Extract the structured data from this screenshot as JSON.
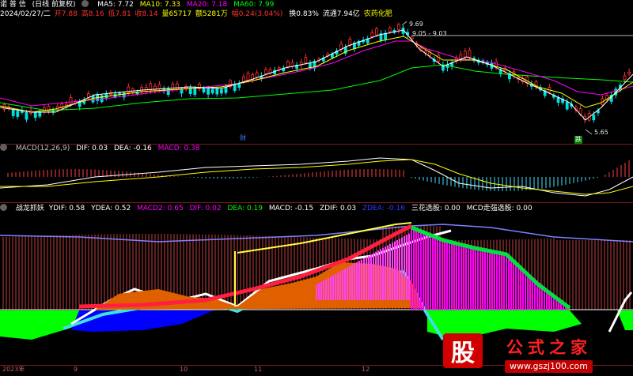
{
  "header": {
    "stock_name": "诺 普 信",
    "mode": "(日线 前复权)",
    "ma5_label": "MA5: 7.72",
    "ma10_label": "MA10: 7.33",
    "ma20_label": "MA20: 7.18",
    "ma60_label": "MA60: 7.99"
  },
  "quote": {
    "date": "2024/02/27/二",
    "open": "开7.88",
    "high": "高8.16",
    "low": "低7.81",
    "close": "收8.14",
    "volume": "量65717",
    "amount": "额5281万",
    "change": "幅0.24(3.04%)",
    "turnover": "换0.83%",
    "float_cap": "流通7.94亿",
    "sector": "农药化肥"
  },
  "price_pane": {
    "high_label": "9.69",
    "range_label": "9.05 - 9.03",
    "low_label": "5.65",
    "marker_cai": "财",
    "marker_die": "跌"
  },
  "macd_pane": {
    "title": "MACD(12,26,9)",
    "dif": "DIF: 0.03",
    "dea": "DEA: -0.16",
    "macd": "MACD: 0.38"
  },
  "indicator_pane": {
    "title": "战龙抓妖",
    "ydif": "YDIF: 0.58",
    "ydea": "YDEA: 0.52",
    "macd2": "MACD2: 0.65",
    "dif": "DIF: 0.02",
    "dea": "DEA: 0.19",
    "macd": "MACD: -0.15",
    "zdif": "ZDIF: 0.03",
    "zdea": "ZDEA: -0.16",
    "sanhua": "三花选股: 0.00",
    "mcd": "MCD走强选股: 0.00"
  },
  "x_axis": {
    "labels": [
      "2023年",
      "9",
      "10",
      "11",
      "12"
    ]
  },
  "watermark": {
    "logo_char": "股",
    "site_name": "公式之家",
    "url": "www.gszj100.com"
  },
  "colors": {
    "up": "#ff3030",
    "down": "#00ffff",
    "ma5": "#ffffff",
    "ma10": "#ffff00",
    "ma20": "#ff00ff",
    "ma60": "#00ff00",
    "orange_area": "#e06000",
    "magenta_area": "#ff00ff",
    "green_band": "#00ff00",
    "blue_band": "#0000ff"
  }
}
